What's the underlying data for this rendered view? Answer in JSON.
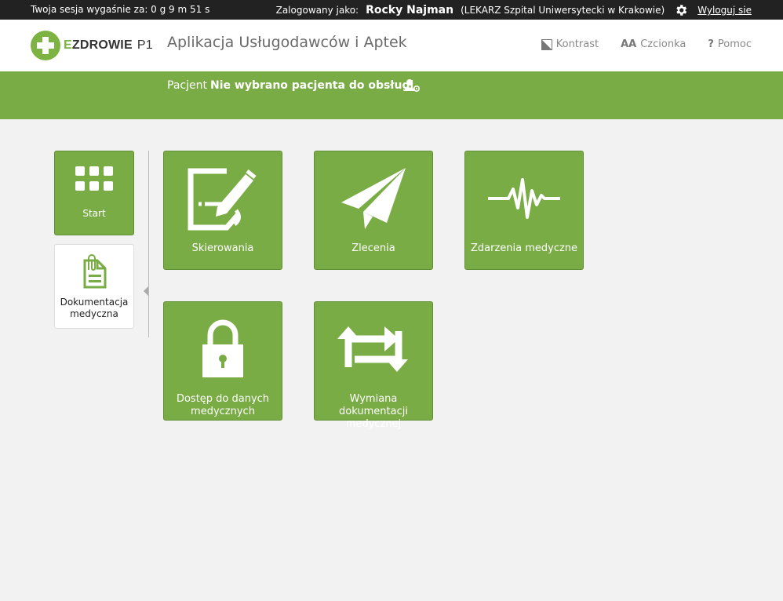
{
  "session": {
    "expires_text": "Twoja sesja wygaśnie za: 0 g 9 m 51 s"
  },
  "user": {
    "logged_as_label": "Zalogowany jako:",
    "name": "Rocky Najman",
    "role": "(LEKARZ Szpital Uniwersytecki w Krakowie)",
    "settings_icon": "gear-icon",
    "logout_label": "Wyloguj sie"
  },
  "header": {
    "logo": {
      "e": "E",
      "brand": "ZDROWIE",
      "p1": "P1"
    },
    "title": "Aplikacja Usługodawców i Aptek",
    "tools": [
      {
        "label": "Kontrast",
        "icon": "contrast-icon"
      },
      {
        "label": "Czcionka",
        "icon": "font-size-icon",
        "glyph": "AA"
      },
      {
        "label": "Pomoc",
        "icon": "help-icon",
        "glyph": "?"
      }
    ]
  },
  "patient": {
    "label": "Pacjent",
    "value": "Nie wybrano pacjenta do obsługi",
    "select_icon": "patient-settings-icon"
  },
  "sidebar": {
    "items": [
      {
        "label": "Start",
        "icon": "grid-icon",
        "active": false
      },
      {
        "label": "Dokumentacja medyczna",
        "icon": "medical-document-icon",
        "active": true
      }
    ]
  },
  "tiles": [
    {
      "label": "Skierowania",
      "icon": "referral-edit-icon"
    },
    {
      "label": "Zlecenia",
      "icon": "paper-plane-icon"
    },
    {
      "label": "Zdarzenia medyczne",
      "icon": "heartbeat-icon"
    },
    {
      "label": "Dostęp do danych medycznych",
      "icon": "lock-icon"
    },
    {
      "label": "Wymiana dokumentacji medycznej",
      "icon": "exchange-icon"
    }
  ],
  "colors": {
    "accent": "#79ac44",
    "topbar": "#222222",
    "background": "#f2f2f2"
  }
}
